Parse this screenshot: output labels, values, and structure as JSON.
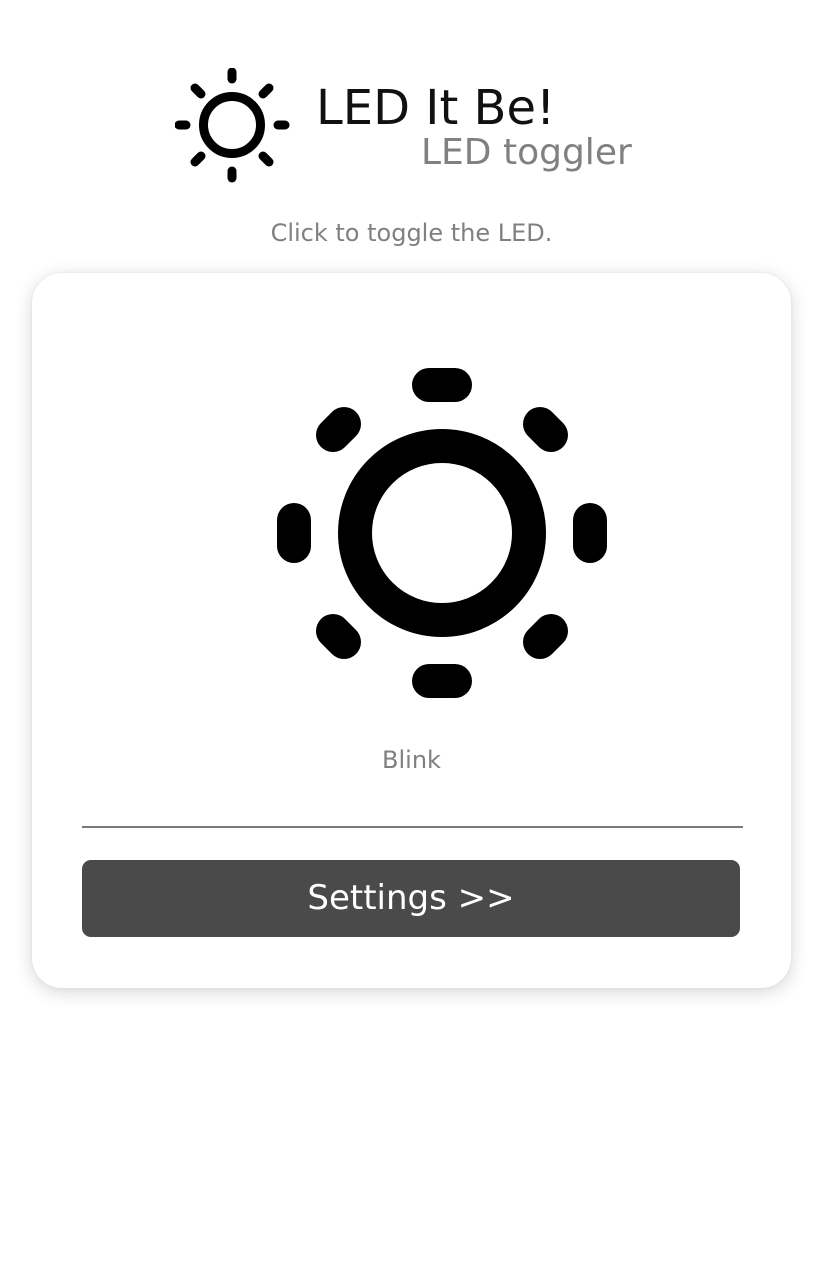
{
  "header": {
    "logo_icon": "sun-icon",
    "title": "LED It Be!",
    "subtitle": "LED toggler"
  },
  "instruction": "Click to toggle the LED.",
  "led": {
    "icon": "sun-icon",
    "state": "off",
    "mode_label": "Blink"
  },
  "settings_button": {
    "label": "Settings >>"
  },
  "colors": {
    "background": "#ffffff",
    "icon": "#000000",
    "title": "#111111",
    "muted_text": "#808080",
    "button_background": "#4a4a4a",
    "button_text": "#ffffff"
  }
}
